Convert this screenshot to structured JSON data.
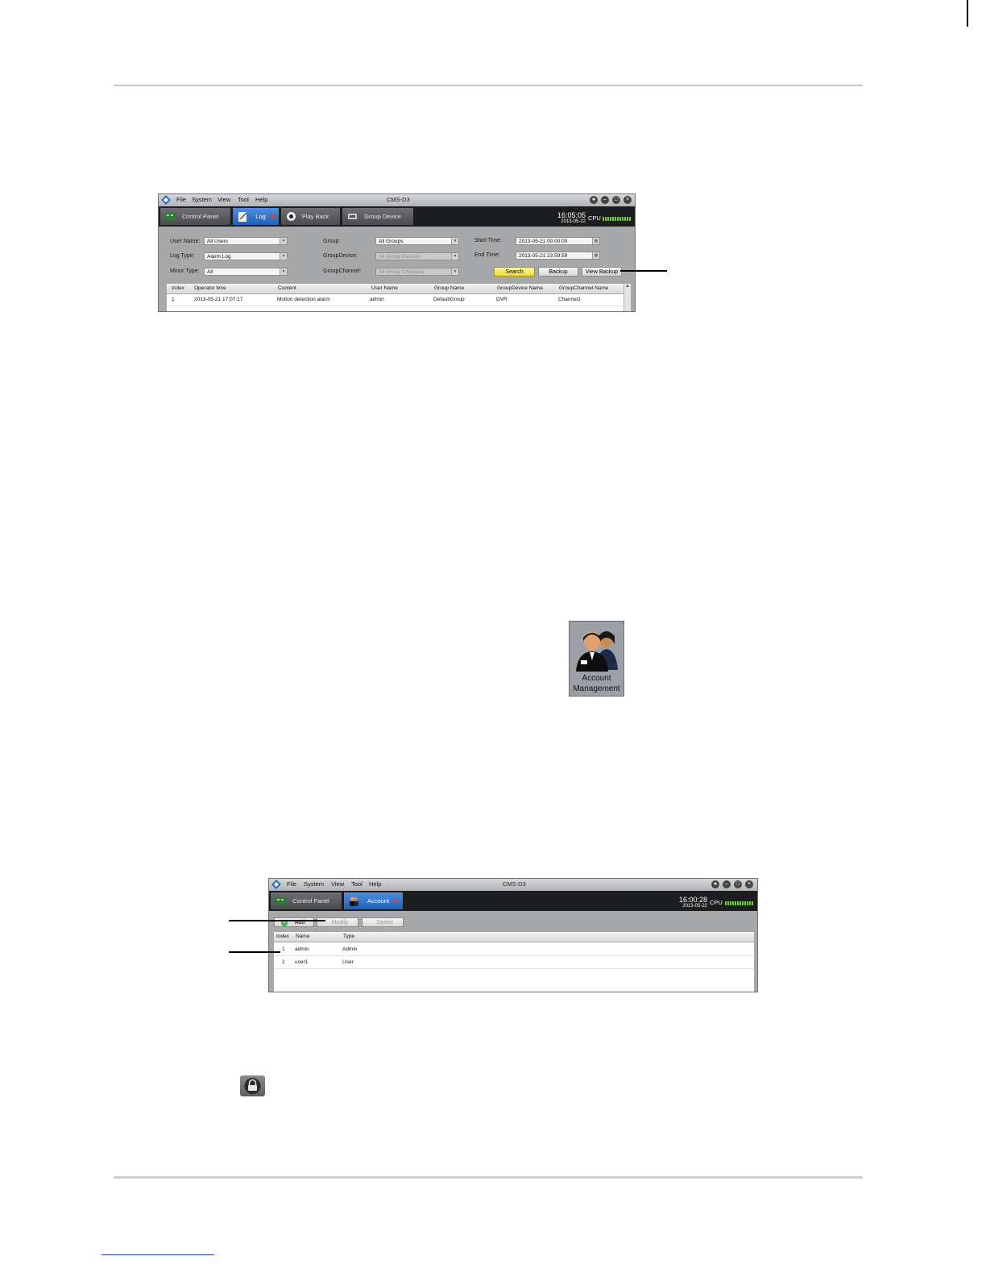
{
  "log_window": {
    "menu": [
      "File",
      "System",
      "View",
      "Tool",
      "Help"
    ],
    "title": "CMS-D3",
    "tabs": [
      {
        "label": "Control Panel",
        "icon": "control-panel-icon"
      },
      {
        "label": "Log",
        "icon": "log-icon"
      },
      {
        "label": "Play Back",
        "icon": "playback-icon"
      },
      {
        "label": "Group Device",
        "icon": "group-device-icon"
      }
    ],
    "clock_time": "16:05:05",
    "clock_date": "2013-05-22",
    "cpu_label": "CPU",
    "filters": {
      "user_name_label": "User Name:",
      "user_name_value": "All Users",
      "log_type_label": "Log Type:",
      "log_type_value": "Alarm Log",
      "minor_type_label": "Minor Type:",
      "minor_type_value": "All",
      "group_label": "Group:",
      "group_value": "All Groups",
      "group_device_label": "GroupDevice:",
      "group_device_value": "All Group Devices",
      "group_channel_label": "GroupChannel:",
      "group_channel_value": "All Group Channels",
      "start_time_label": "Start Time:",
      "start_time_value": "2013-05-21 00:00:00",
      "end_time_label": "End Time:",
      "end_time_value": "2013-05-21 23:59:59"
    },
    "buttons": {
      "search": "Search",
      "backup": "Backup",
      "view_backup": "View Backup"
    },
    "columns": [
      "Index",
      "Operator time",
      "Content",
      "User Name",
      "Group Name",
      "GroupDevice Name",
      "GroupChannel Name"
    ],
    "rows": [
      [
        "1",
        "2013-05-21 17:07:17",
        "Motion detection alarm",
        "admin",
        "DefaultGroup",
        "DVR",
        "Channel1"
      ]
    ]
  },
  "account_icon": {
    "line1": "Account",
    "line2": "Management"
  },
  "account_window": {
    "menu": [
      "File",
      "System",
      "View",
      "Tool",
      "Help"
    ],
    "title": "CMS-D3",
    "tabs": [
      {
        "label": "Control Panel",
        "icon": "control-panel-icon"
      },
      {
        "label": "Account",
        "icon": "account-icon"
      }
    ],
    "clock_time": "16:00:28",
    "clock_date": "2013-05-22",
    "cpu_label": "CPU",
    "toolbar": {
      "add": "Add",
      "modify": "Modify",
      "delete": "Delete"
    },
    "columns": [
      "Index",
      "Name",
      "Type"
    ],
    "rows": [
      [
        "1",
        "admin",
        "Admin"
      ],
      [
        "2",
        "user1",
        "User"
      ]
    ]
  },
  "colors": {
    "accent_tab": "#2f72cf",
    "search_button": "#f2dc32",
    "cpu_meter": "#6cd11b"
  }
}
